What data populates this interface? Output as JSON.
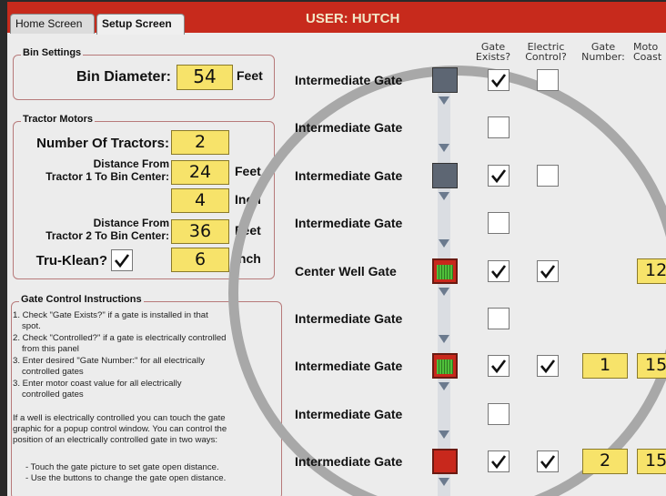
{
  "tabs": {
    "home": "Home Screen",
    "setup": "Setup Screen"
  },
  "user": "USER: HUTCH",
  "bin": {
    "group_title": "Bin Settings",
    "diameter_label": "Bin Diameter:",
    "diameter_value": "54",
    "diameter_unit": "Feet"
  },
  "tractors": {
    "group_title": "Tractor Motors",
    "count_label": "Number Of Tractors:",
    "count_value": "2",
    "t1_label_a": "Distance From",
    "t1_label_b": "Tractor 1 To Bin Center:",
    "t1_feet": "24",
    "t1_inch": "4",
    "t2_label_a": "Distance From",
    "t2_label_b": "Tractor 2 To Bin Center:",
    "t2_feet": "36",
    "feet_unit": "Feet",
    "inch_unit": "Inch",
    "truklean_label": "Tru-Klean?",
    "truklean_checked": true,
    "truklean_value": "6"
  },
  "instructions": {
    "group_title": "Gate Control Instructions",
    "steps": [
      "1. Check \"Gate Exists?\" if a gate is installed in that",
      "spot.",
      "2. Check \"Controlled?\" if a gate is electrically controlled",
      "from this panel",
      "3. Enter desired \"Gate Number:\" for all electrically",
      "controlled gates",
      "3. Enter motor coast value for all electrically",
      "controlled gates"
    ],
    "note_lines": [
      "If a well is electrically controlled you can touch the gate",
      "graphic for a popup control window. You can control the",
      "position of an electrically controlled gate in two ways:"
    ],
    "bullets": [
      "- Touch the gate picture to set gate open distance.",
      "- Use the buttons to change the gate open distance."
    ]
  },
  "columns": {
    "gate_exists": [
      "Gate",
      "Exists?"
    ],
    "electric_control": [
      "Electric",
      "Control?"
    ],
    "gate_number": [
      "Gate",
      "Number:"
    ],
    "motor_coast": [
      "Moto",
      "Coast"
    ]
  },
  "gates": [
    {
      "label": "Intermediate Gate",
      "graphic": "gray",
      "exists": true,
      "electric": false,
      "number": "",
      "coast": ""
    },
    {
      "label": "Intermediate Gate",
      "graphic": "none",
      "exists": false,
      "electric": null,
      "number": "",
      "coast": ""
    },
    {
      "label": "Intermediate Gate",
      "graphic": "gray",
      "exists": true,
      "electric": false,
      "number": "",
      "coast": ""
    },
    {
      "label": "Intermediate Gate",
      "graphic": "none",
      "exists": false,
      "electric": null,
      "number": "",
      "coast": ""
    },
    {
      "label": "Center Well Gate",
      "graphic": "green",
      "exists": true,
      "electric": true,
      "number": "",
      "coast": "12"
    },
    {
      "label": "Intermediate Gate",
      "graphic": "none",
      "exists": false,
      "electric": null,
      "number": "",
      "coast": ""
    },
    {
      "label": "Intermediate Gate",
      "graphic": "green",
      "exists": true,
      "electric": true,
      "number": "1",
      "coast": "15"
    },
    {
      "label": "Intermediate Gate",
      "graphic": "none",
      "exists": false,
      "electric": null,
      "number": "",
      "coast": ""
    },
    {
      "label": "Intermediate Gate",
      "graphic": "red",
      "exists": true,
      "electric": true,
      "number": "2",
      "coast": "15"
    }
  ],
  "colors": {
    "title_bar": "#c72a1c",
    "field": "#f7e36a",
    "gate_gray": "#5d6673",
    "gate_red": "#c8281c",
    "gate_green": "#4fbf3a"
  }
}
